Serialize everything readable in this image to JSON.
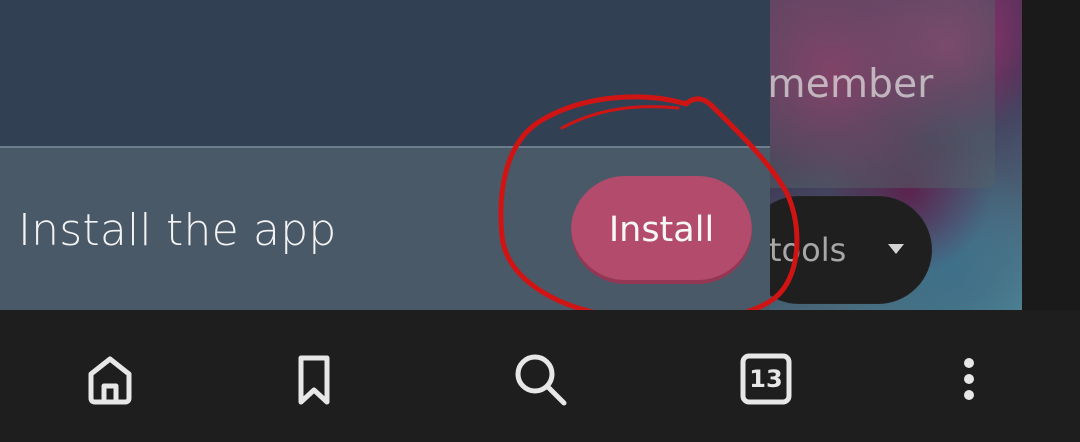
{
  "background_page": {
    "card_text": "g member",
    "pill_label": "tools",
    "pill_caret_icon": "caret-down-icon"
  },
  "install_banner": {
    "prompt_text": "Install the app",
    "button_label": "Install"
  },
  "annotation": {
    "shape": "hand-drawn-circle",
    "color": "#d01414"
  },
  "bottom_nav": {
    "items": [
      {
        "icon": "home-icon"
      },
      {
        "icon": "bookmark-icon"
      },
      {
        "icon": "search-icon"
      },
      {
        "icon": "tabs-icon",
        "count": "13"
      },
      {
        "icon": "more-vertical-icon"
      }
    ]
  },
  "colors": {
    "overlay_top": "#314153",
    "overlay_bottom": "#4a5968",
    "install_button": "#b34b6c",
    "nav_background": "#1e1e1e",
    "nav_icon": "#e7e7e7"
  }
}
